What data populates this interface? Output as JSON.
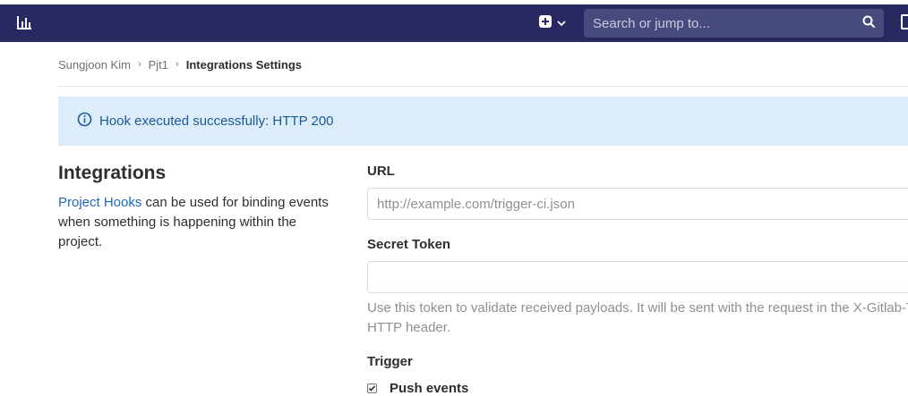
{
  "navbar": {
    "search_placeholder": "Search or jump to...",
    "logo_icon": "chart-bars-icon",
    "plus_icon": "plus-square-icon",
    "dropdown_icon": "chevron-down-icon",
    "search_icon": "search-icon",
    "background_color": "#292961"
  },
  "breadcrumb": {
    "items": [
      "Sungjoon Kim",
      "Pjt1"
    ],
    "current": "Integrations Settings"
  },
  "alert": {
    "message": "Hook executed successfully: HTTP 200",
    "icon": "info-circle-icon",
    "background_color": "#dcecf9",
    "text_color": "#1b5996"
  },
  "integrations": {
    "title": "Integrations",
    "link_text": "Project Hooks",
    "description_rest": " can be used for binding events when something is happening within the project.",
    "link_color": "#1f68b8"
  },
  "form": {
    "url_label": "URL",
    "url_placeholder": "http://example.com/trigger-ci.json",
    "secret_label": "Secret Token",
    "secret_value": "",
    "secret_help": "Use this token to validate received payloads. It will be sent with the request in the X-Gitlab-To",
    "secret_help_2": "HTTP header.",
    "trigger_label": "Trigger",
    "push_events_label": "Push events",
    "push_events_checked": true
  }
}
